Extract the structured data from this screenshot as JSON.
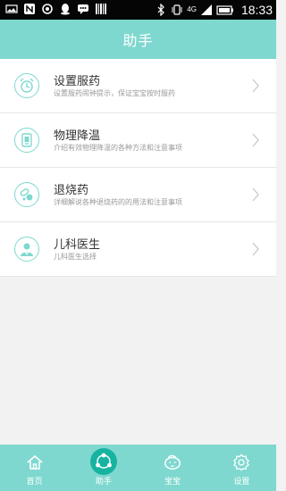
{
  "status_bar": {
    "time": "18:33",
    "network": "4G",
    "icons": [
      "image-icon",
      "nfc-icon",
      "settings-icon",
      "qq-icon",
      "chat-icon",
      "barcode-icon",
      "bluetooth-icon",
      "vibrate-icon",
      "signal-icon",
      "battery-icon"
    ]
  },
  "header": {
    "title": "助手"
  },
  "items": [
    {
      "title": "设置服药",
      "subtitle": "设置服药闹钟提示，保证宝宝按时服药",
      "icon": "alarm-clock-icon"
    },
    {
      "title": "物理降温",
      "subtitle": "介绍有效物理降温的各种方法和注意事项",
      "icon": "thermometer-icon"
    },
    {
      "title": "退烧药",
      "subtitle": "详细解说各种退烧药的的用法和注意事项",
      "icon": "pills-icon"
    },
    {
      "title": "儿科医生",
      "subtitle": "儿科医生选择",
      "icon": "doctor-icon"
    }
  ],
  "tabs": [
    {
      "label": "首页",
      "icon": "home-icon",
      "active": false
    },
    {
      "label": "助手",
      "icon": "assistant-icon",
      "active": true
    },
    {
      "label": "宝宝",
      "icon": "baby-icon",
      "active": false
    },
    {
      "label": "设置",
      "icon": "gear-icon",
      "active": false
    }
  ],
  "colors": {
    "accent": "#7fd8cf",
    "active_tab": "#17b3a1"
  }
}
